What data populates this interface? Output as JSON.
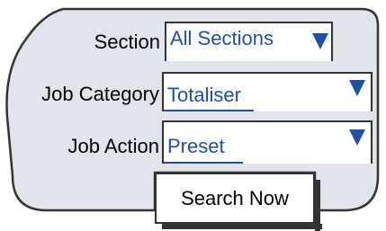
{
  "form": {
    "section_label": "Section",
    "section_value": "All Sections",
    "job_category_label": "Job Category",
    "job_category_value": "Totaliser",
    "job_action_label": "Job Action",
    "job_action_value": "Preset",
    "search_label": "Search Now"
  },
  "colors": {
    "panel_fill": "#dfe5ea",
    "value_text": "#1f4fa8",
    "border": "#333333"
  },
  "icons": {
    "dropdown": "triangle-down-icon"
  }
}
